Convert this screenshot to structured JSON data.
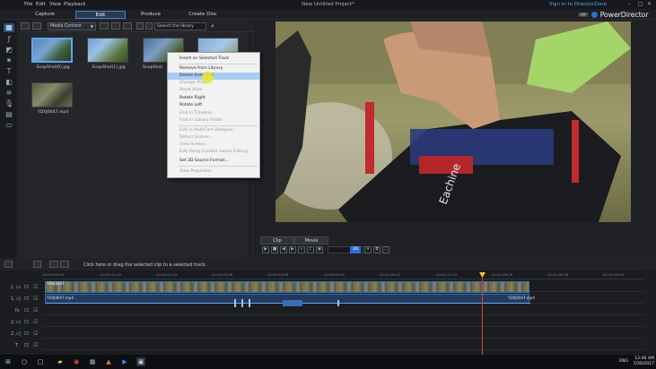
{
  "menu": {
    "file": "File",
    "edit": "Edit",
    "view": "View",
    "playback": "Playback"
  },
  "window": {
    "title": "New Untitled Project*",
    "sign_in": "Sign in to DirectorZone",
    "minimize": "–",
    "maximize": "□",
    "close": "✕"
  },
  "tabs": {
    "capture": "Capture",
    "edit": "Edit",
    "produce": "Produce",
    "create_disc": "Create Disc"
  },
  "brand": {
    "badge": "APP",
    "name": "PowerDirector"
  },
  "media_room": {
    "dropdown": "Media Content",
    "search_placeholder": "Search the library",
    "items": [
      {
        "label": "SnapShot(0).jpg"
      },
      {
        "label": "SnapShot(1).jpg"
      },
      {
        "label": "SnapShot"
      },
      {
        "label": "YDXJ0047.mp4"
      }
    ]
  },
  "context_menu": {
    "items": [
      {
        "label": "Insert on Selected Track",
        "enabled": true
      },
      {
        "label": "Remove from Library",
        "enabled": true
      },
      {
        "label": "Delete from Disk",
        "enabled": true
      },
      {
        "label": "Change Alias",
        "enabled": false
      },
      {
        "label": "Reset Alias",
        "enabled": false
      },
      {
        "label": "Rotate Right",
        "enabled": true
      },
      {
        "label": "Rotate Left",
        "enabled": true
      },
      {
        "label": "Find in Timeline",
        "enabled": false
      },
      {
        "label": "Find in Library Folder",
        "enabled": false
      },
      {
        "label": "Edit in MultiCam Designer...",
        "enabled": false
      },
      {
        "label": "Detect Scenes...",
        "enabled": false
      },
      {
        "label": "View Scenes",
        "enabled": false
      },
      {
        "label": "Edit Using Content Aware Editing...",
        "enabled": false
      },
      {
        "label": "Set 3D Source Format...",
        "enabled": true
      },
      {
        "label": "View Properties",
        "enabled": false
      }
    ]
  },
  "preview": {
    "clip_tab": "Clip",
    "movie_tab": "Movie",
    "mode_3d": "3D"
  },
  "timeline": {
    "hint": "Click here or drag the selected clip to a selected track.",
    "ticks": [
      "00:00:00:00",
      "00:00:11:02",
      "00:00:22:04",
      "00:00:33:06",
      "00:00:44:08",
      "00:00:55:10",
      "00:01:06:12",
      "00:01:17:14",
      "00:01:28:16",
      "00:01:39:18",
      "00:01:50:20",
      "00:02:01:22"
    ],
    "tracks": [
      {
        "label": "1."
      },
      {
        "label": "1."
      },
      {
        "label": "fx"
      },
      {
        "label": "2."
      },
      {
        "label": "2."
      },
      {
        "label": "T"
      },
      {
        "label": "♪"
      }
    ],
    "clip_video_label": "YDXJ0047",
    "clip_audio_label": "YDXJ0047.mp4",
    "clip_audio_label_end": "YDXJ0047.mp4"
  },
  "taskbar": {
    "lang": "ENG",
    "time": "12:06 AM",
    "date": "7/30/2017"
  }
}
